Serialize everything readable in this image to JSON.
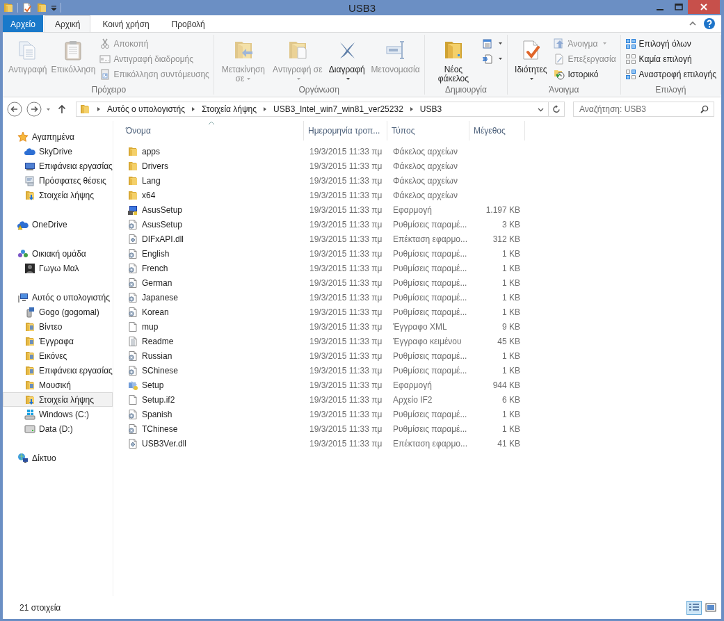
{
  "window": {
    "title": "USB3"
  },
  "tabs": [
    {
      "label": "Αρχείο",
      "kind": "menu",
      "selected": false
    },
    {
      "label": "Αρχική",
      "kind": "tab",
      "selected": true
    },
    {
      "label": "Κοινή χρήση",
      "kind": "tab",
      "selected": false
    },
    {
      "label": "Προβολή",
      "kind": "tab",
      "selected": false
    }
  ],
  "ribbon": {
    "groups": [
      {
        "label": "Πρόχειρο",
        "columns": [
          {
            "kind": "large",
            "label": "Αντιγραφή",
            "disabled": true,
            "dropdown": false
          },
          {
            "kind": "large",
            "label": "Επικόλληση",
            "disabled": true,
            "dropdown": false
          },
          {
            "kind": "stack",
            "items": [
              {
                "label": "Αποκοπή",
                "disabled": true,
                "dropdown": false
              },
              {
                "label": "Αντιγραφή διαδρομής",
                "disabled": true,
                "dropdown": false
              },
              {
                "label": "Επικόλληση συντόμευσης",
                "disabled": true,
                "dropdown": false
              }
            ]
          }
        ]
      },
      {
        "label": "Οργάνωση",
        "columns": [
          {
            "kind": "large",
            "label": "Μετακίνηση σε",
            "disabled": true,
            "dropdown": true
          },
          {
            "kind": "large",
            "label": "Αντιγραφή σε",
            "disabled": true,
            "dropdown": true
          },
          {
            "kind": "large",
            "label": "Διαγραφή",
            "disabled": false,
            "dropdown": true
          },
          {
            "kind": "large",
            "label": "Μετονομασία",
            "disabled": true,
            "dropdown": false
          }
        ]
      },
      {
        "label": "Δημιουργία",
        "columns": [
          {
            "kind": "large",
            "label": "Νέος φάκελος",
            "disabled": false,
            "dropdown": false
          },
          {
            "kind": "stack",
            "items": [
              {
                "disabled": false,
                "dropdown": true
              },
              {
                "disabled": false,
                "dropdown": true
              }
            ]
          }
        ]
      },
      {
        "label": "Άνοιγμα",
        "columns": [
          {
            "kind": "large",
            "label": "Ιδιότητες",
            "disabled": false,
            "dropdown": true
          },
          {
            "kind": "stack",
            "items": [
              {
                "label": "Άνοιγμα",
                "disabled": true,
                "dropdown": true
              },
              {
                "label": "Επεξεργασία",
                "disabled": true,
                "dropdown": false
              },
              {
                "label": "Ιστορικό",
                "disabled": false,
                "dropdown": false
              }
            ]
          }
        ]
      },
      {
        "label": "Επιλογή",
        "columns": [
          {
            "kind": "stack",
            "items": [
              {
                "label": "Επιλογή όλων",
                "disabled": false,
                "dropdown": false
              },
              {
                "label": "Καμία επιλογή",
                "disabled": false,
                "dropdown": false
              },
              {
                "label": "Αναστροφή επιλογής",
                "disabled": false,
                "dropdown": false
              }
            ]
          }
        ]
      }
    ]
  },
  "address": {
    "path": [
      "Αυτός ο υπολογιστής",
      "Στοιχεία λήψης",
      "USB3_Intel_win7_win81_ver25232",
      "USB3"
    ]
  },
  "search": {
    "placeholder": "Αναζήτηση: USB3"
  },
  "navigation": [
    {
      "label": "Αγαπημένα",
      "kind": "star",
      "selected": false,
      "children": [
        {
          "label": "SkyDrive",
          "kind": "cloud",
          "selected": false
        },
        {
          "label": "Επιφάνεια εργασίας",
          "kind": "desktop",
          "selected": false
        },
        {
          "label": "Πρόσφατες θέσεις",
          "kind": "recent",
          "selected": false
        },
        {
          "label": "Στοιχεία λήψης",
          "kind": "downloads",
          "selected": false
        }
      ]
    },
    {
      "label": "OneDrive",
      "kind": "onedrive",
      "selected": false
    },
    {
      "label": "Οικιακή ομάδα",
      "kind": "homegroup",
      "selected": false,
      "children": [
        {
          "label": "Γωγω Μαλ",
          "kind": "user",
          "selected": false
        }
      ]
    },
    {
      "label": "Αυτός ο υπολογιστής",
      "kind": "computer",
      "selected": false,
      "children": [
        {
          "label": "Gogo (gogomal)",
          "kind": "device",
          "selected": false
        },
        {
          "label": "Βίντεο",
          "kind": "libfolder",
          "selected": false
        },
        {
          "label": "Έγγραφα",
          "kind": "libfolder",
          "selected": false
        },
        {
          "label": "Εικόνες",
          "kind": "libfolder",
          "selected": false
        },
        {
          "label": "Επιφάνεια εργασίας",
          "kind": "libfolder",
          "selected": false
        },
        {
          "label": "Μουσική",
          "kind": "libfolder",
          "selected": false
        },
        {
          "label": "Στοιχεία λήψης",
          "kind": "downloads",
          "selected": true
        },
        {
          "label": "Windows (C:)",
          "kind": "windrive",
          "selected": false
        },
        {
          "label": "Data (D:)",
          "kind": "drive",
          "selected": false
        }
      ]
    },
    {
      "label": "Δίκτυο",
      "kind": "network",
      "selected": false
    }
  ],
  "table": {
    "columns": [
      {
        "label": "Όνομα",
        "sorted": true
      },
      {
        "label": "Ημερομηνία τροπ...",
        "sorted": false
      },
      {
        "label": "Τύπος",
        "sorted": false
      },
      {
        "label": "Μέγεθος",
        "sorted": false
      }
    ],
    "rows": [
      {
        "name": "apps",
        "kind": "folder",
        "date": "19/3/2015 11:33 πμ",
        "type": "Φάκελος αρχείων"
      },
      {
        "name": "Drivers",
        "kind": "folder",
        "date": "19/3/2015 11:33 πμ",
        "type": "Φάκελος αρχείων"
      },
      {
        "name": "Lang",
        "kind": "folder",
        "date": "19/3/2015 11:33 πμ",
        "type": "Φάκελος αρχείων"
      },
      {
        "name": "x64",
        "kind": "folder",
        "date": "19/3/2015 11:33 πμ",
        "type": "Φάκελος αρχείων"
      },
      {
        "name": "AsusSetup",
        "kind": "app",
        "date": "19/3/2015 11:33 πμ",
        "type": "Εφαρμογή",
        "size": "1.197 KB"
      },
      {
        "name": "AsusSetup",
        "kind": "settings",
        "date": "19/3/2015 11:33 πμ",
        "type": "Ρυθμίσεις παραμέ...",
        "size": "3 KB"
      },
      {
        "name": "DIFxAPI.dll",
        "kind": "dll",
        "date": "19/3/2015 11:33 πμ",
        "type": "Επέκταση εφαρμο...",
        "size": "312 KB"
      },
      {
        "name": "English",
        "kind": "settings",
        "date": "19/3/2015 11:33 πμ",
        "type": "Ρυθμίσεις παραμέ...",
        "size": "1 KB"
      },
      {
        "name": "French",
        "kind": "settings",
        "date": "19/3/2015 11:33 πμ",
        "type": "Ρυθμίσεις παραμέ...",
        "size": "1 KB"
      },
      {
        "name": "German",
        "kind": "settings",
        "date": "19/3/2015 11:33 πμ",
        "type": "Ρυθμίσεις παραμέ...",
        "size": "1 KB"
      },
      {
        "name": "Japanese",
        "kind": "settings",
        "date": "19/3/2015 11:33 πμ",
        "type": "Ρυθμίσεις παραμέ...",
        "size": "1 KB"
      },
      {
        "name": "Korean",
        "kind": "settings",
        "date": "19/3/2015 11:33 πμ",
        "type": "Ρυθμίσεις παραμέ...",
        "size": "1 KB"
      },
      {
        "name": "mup",
        "kind": "file",
        "date": "19/3/2015 11:33 πμ",
        "type": "Έγγραφο XML",
        "size": "9 KB"
      },
      {
        "name": "Readme",
        "kind": "text",
        "date": "19/3/2015 11:33 πμ",
        "type": "Έγγραφο κειμένου",
        "size": "45 KB"
      },
      {
        "name": "Russian",
        "kind": "settings",
        "date": "19/3/2015 11:33 πμ",
        "type": "Ρυθμίσεις παραμέ...",
        "size": "1 KB"
      },
      {
        "name": "SChinese",
        "kind": "settings",
        "date": "19/3/2015 11:33 πμ",
        "type": "Ρυθμίσεις παραμέ...",
        "size": "1 KB"
      },
      {
        "name": "Setup",
        "kind": "installer",
        "date": "19/3/2015 11:33 πμ",
        "type": "Εφαρμογή",
        "size": "944 KB"
      },
      {
        "name": "Setup.if2",
        "kind": "file",
        "date": "19/3/2015 11:33 πμ",
        "type": "Αρχείο IF2",
        "size": "6 KB"
      },
      {
        "name": "Spanish",
        "kind": "settings",
        "date": "19/3/2015 11:33 πμ",
        "type": "Ρυθμίσεις παραμέ...",
        "size": "1 KB"
      },
      {
        "name": "TChinese",
        "kind": "settings",
        "date": "19/3/2015 11:33 πμ",
        "type": "Ρυθμίσεις παραμέ...",
        "size": "1 KB"
      },
      {
        "name": "USB3Ver.dll",
        "kind": "dll",
        "date": "19/3/2015 11:33 πμ",
        "type": "Επέκταση εφαρμο...",
        "size": "41 KB"
      }
    ]
  },
  "status_bar": {
    "text": "21 στοιχεία",
    "views": [
      {
        "kind": "details",
        "selected": true
      },
      {
        "kind": "large-icons",
        "selected": false
      }
    ]
  }
}
